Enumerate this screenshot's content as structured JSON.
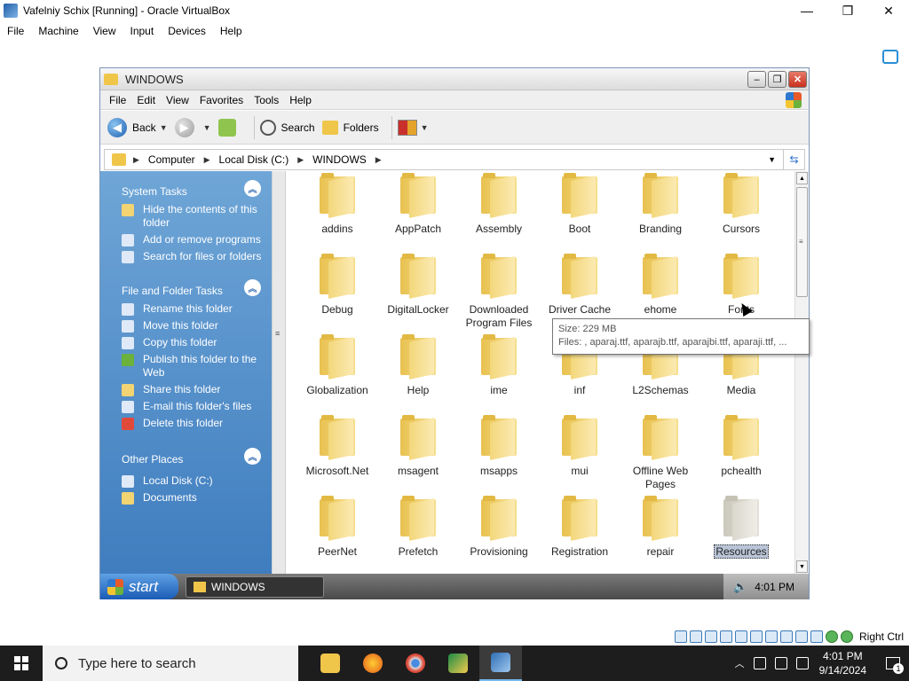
{
  "host_window": {
    "title": "Vafelniy  Schix [Running] - Oracle VirtualBox",
    "controls": [
      "—",
      "❐",
      "✕"
    ],
    "menu": [
      "File",
      "Machine",
      "View",
      "Input",
      "Devices",
      "Help"
    ],
    "status_host_key": "Right Ctrl"
  },
  "explorer": {
    "title": "WINDOWS",
    "menu": [
      "File",
      "Edit",
      "View",
      "Favorites",
      "Tools",
      "Help"
    ],
    "toolbar": {
      "back_label": "Back",
      "search_label": "Search",
      "folders_label": "Folders"
    },
    "address": {
      "crumbs": [
        "Computer",
        "Local Disk (C:)",
        "WINDOWS"
      ]
    },
    "task_pane": {
      "system_tasks": {
        "title": "System Tasks",
        "items": [
          "Hide the contents of this folder",
          "Add or remove programs",
          "Search for files or folders"
        ]
      },
      "file_folder_tasks": {
        "title": "File and Folder Tasks",
        "items": [
          "Rename this folder",
          "Move this folder",
          "Copy this folder",
          "Publish this folder to the Web",
          "Share this folder",
          "E-mail this folder's files",
          "Delete this folder"
        ]
      },
      "other_places": {
        "title": "Other Places",
        "items": [
          "Local Disk (C:)",
          "Documents"
        ]
      }
    },
    "folders": [
      "addins",
      "AppPatch",
      "Assembly",
      "Boot",
      "Branding",
      "Cursors",
      "Debug",
      "DigitalLocker",
      "Downloaded Program Files",
      "Driver Cache",
      "ehome",
      "Fonts",
      "Globalization",
      "Help",
      "ime",
      "inf",
      "L2Schemas",
      "Media",
      "Microsoft.Net",
      "msagent",
      "msapps",
      "mui",
      "Offline Web Pages",
      "pchealth",
      "PeerNet",
      "Prefetch",
      "Provisioning",
      "Registration",
      "repair",
      "Resources"
    ],
    "selected_folder": "Resources",
    "tooltip": {
      "size": "Size: 229 MB",
      "files": "Files: , aparaj.ttf, aparajb.ttf, aparajbi.ttf, aparaji.ttf, ..."
    }
  },
  "guest_taskbar": {
    "start_label": "start",
    "task_button": "WINDOWS",
    "time": "4:01 PM"
  },
  "win_taskbar": {
    "search_placeholder": "Type here to search",
    "time": "4:01 PM",
    "date": "9/14/2024",
    "notification_count": "1"
  }
}
